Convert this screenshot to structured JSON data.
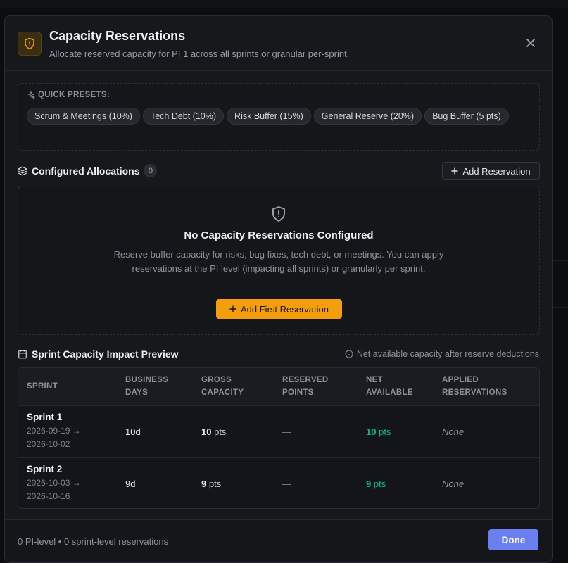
{
  "header": {
    "title": "Capacity Reservations",
    "subtitle": "Allocate reserved capacity for PI 1 across all sprints or granular per-sprint."
  },
  "presets": {
    "label": "QUICK PRESETS:",
    "items": [
      "Scrum & Meetings (10%)",
      "Tech Debt (10%)",
      "Risk Buffer (15%)",
      "General Reserve (20%)",
      "Bug Buffer (5 pts)"
    ]
  },
  "allocations": {
    "title": "Configured Allocations",
    "count": "0",
    "add_label": "Add Reservation"
  },
  "empty_state": {
    "title": "No Capacity Reservations Configured",
    "description": "Reserve buffer capacity for risks, bug fixes, tech debt, or meetings. You can apply reservations at the PI level (impacting all sprints) or granularly per sprint.",
    "button_label": "Add First Reservation"
  },
  "preview": {
    "title": "Sprint Capacity Impact Preview",
    "note": "Net available capacity after reserve deductions",
    "columns": [
      "SPRINT",
      "BUSINESS DAYS",
      "GROSS CAPACITY",
      "RESERVED POINTS",
      "NET AVAILABLE",
      "APPLIED RESERVATIONS"
    ],
    "rows": [
      {
        "name": "Sprint 1",
        "start": "2026-09-19 →",
        "end": "2026-10-02",
        "days": "10d",
        "gross": "10",
        "gross_unit": "pts",
        "reserved": "—",
        "net": "10",
        "net_unit": "pts",
        "applied": "None"
      },
      {
        "name": "Sprint 2",
        "start": "2026-10-03 →",
        "end": "2026-10-16",
        "days": "9d",
        "gross": "9",
        "gross_unit": "pts",
        "reserved": "—",
        "net": "9",
        "net_unit": "pts",
        "applied": "None"
      }
    ]
  },
  "footer": {
    "summary": "0 PI-level • 0 sprint-level reservations",
    "done_label": "Done"
  },
  "colors": {
    "accent": "#f59e0b",
    "primary": "#6b7ff0",
    "positive": "#10b981"
  }
}
